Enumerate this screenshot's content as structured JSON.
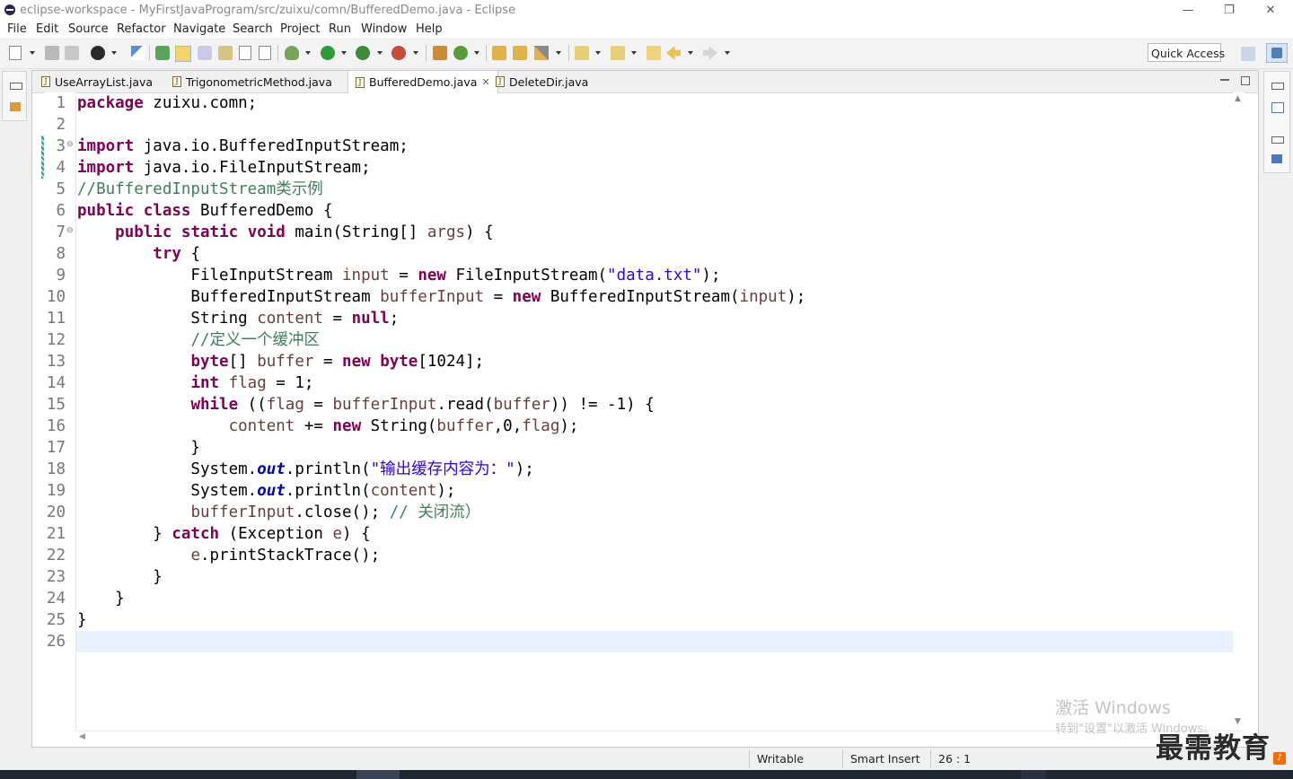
{
  "window": {
    "title": "eclipse-workspace - MyFirstJavaProgram/src/zuixu/comn/BufferedDemo.java - Eclipse",
    "minimize": "—",
    "restore": "❐",
    "close": "✕"
  },
  "menu": [
    "File",
    "Edit",
    "Source",
    "Refactor",
    "Navigate",
    "Search",
    "Project",
    "Run",
    "Window",
    "Help"
  ],
  "quick_access": "Quick Access",
  "tabs": [
    {
      "label": "UseArrayList.java"
    },
    {
      "label": "TrigonometricMethod.java"
    },
    {
      "label": "BufferedDemo.java",
      "active": true,
      "close": "✕"
    },
    {
      "label": "DeleteDir.java"
    }
  ],
  "code": {
    "line_numbers": [
      "1",
      "2",
      "3",
      "4",
      "5",
      "6",
      "7",
      "8",
      "9",
      "10",
      "11",
      "12",
      "13",
      "14",
      "15",
      "16",
      "17",
      "18",
      "19",
      "20",
      "21",
      "22",
      "23",
      "24",
      "25",
      "26"
    ],
    "fold_markers": {
      "3": "⊖",
      "7": "⊖"
    },
    "lines": [
      [
        {
          "t": "package",
          "c": "k"
        },
        {
          "t": " zuixu.comn;"
        }
      ],
      [],
      [
        {
          "t": "import",
          "c": "k"
        },
        {
          "t": " java.io.BufferedInputStream;"
        }
      ],
      [
        {
          "t": "import",
          "c": "k"
        },
        {
          "t": " java.io.FileInputStream;"
        }
      ],
      [
        {
          "t": "//BufferedInputStream类示例",
          "c": "c"
        }
      ],
      [
        {
          "t": "public",
          "c": "k"
        },
        {
          "t": " "
        },
        {
          "t": "class",
          "c": "k"
        },
        {
          "t": " BufferedDemo {"
        }
      ],
      [
        {
          "t": "    "
        },
        {
          "t": "public",
          "c": "k"
        },
        {
          "t": " "
        },
        {
          "t": "static",
          "c": "k"
        },
        {
          "t": " "
        },
        {
          "t": "void",
          "c": "k"
        },
        {
          "t": " main(String[] "
        },
        {
          "t": "args",
          "c": "v"
        },
        {
          "t": ") {"
        }
      ],
      [
        {
          "t": "        "
        },
        {
          "t": "try",
          "c": "k"
        },
        {
          "t": " {"
        }
      ],
      [
        {
          "t": "            FileInputStream "
        },
        {
          "t": "input",
          "c": "v"
        },
        {
          "t": " = "
        },
        {
          "t": "new",
          "c": "k"
        },
        {
          "t": " FileInputStream("
        },
        {
          "t": "\"data.txt\"",
          "c": "s"
        },
        {
          "t": ");"
        }
      ],
      [
        {
          "t": "            BufferedInputStream "
        },
        {
          "t": "bufferInput",
          "c": "v"
        },
        {
          "t": " = "
        },
        {
          "t": "new",
          "c": "k"
        },
        {
          "t": " BufferedInputStream("
        },
        {
          "t": "input",
          "c": "v"
        },
        {
          "t": ");"
        }
      ],
      [
        {
          "t": "            String "
        },
        {
          "t": "content",
          "c": "v"
        },
        {
          "t": " = "
        },
        {
          "t": "null",
          "c": "k"
        },
        {
          "t": ";"
        }
      ],
      [
        {
          "t": "            "
        },
        {
          "t": "//定义一个缓冲区",
          "c": "c"
        }
      ],
      [
        {
          "t": "            "
        },
        {
          "t": "byte",
          "c": "k"
        },
        {
          "t": "[] "
        },
        {
          "t": "buffer",
          "c": "v"
        },
        {
          "t": " = "
        },
        {
          "t": "new",
          "c": "k"
        },
        {
          "t": " "
        },
        {
          "t": "byte",
          "c": "k"
        },
        {
          "t": "[1024];"
        }
      ],
      [
        {
          "t": "            "
        },
        {
          "t": "int",
          "c": "k"
        },
        {
          "t": " "
        },
        {
          "t": "flag",
          "c": "v"
        },
        {
          "t": " = 1;"
        }
      ],
      [
        {
          "t": "            "
        },
        {
          "t": "while",
          "c": "k"
        },
        {
          "t": " (("
        },
        {
          "t": "flag",
          "c": "v"
        },
        {
          "t": " = "
        },
        {
          "t": "bufferInput",
          "c": "v"
        },
        {
          "t": ".read("
        },
        {
          "t": "buffer",
          "c": "v"
        },
        {
          "t": ")) != -1) {"
        }
      ],
      [
        {
          "t": "                "
        },
        {
          "t": "content",
          "c": "v"
        },
        {
          "t": " += "
        },
        {
          "t": "new",
          "c": "k"
        },
        {
          "t": " String("
        },
        {
          "t": "buffer",
          "c": "v"
        },
        {
          "t": ",0,"
        },
        {
          "t": "flag",
          "c": "v"
        },
        {
          "t": ");"
        }
      ],
      [
        {
          "t": "            }"
        }
      ],
      [
        {
          "t": "            System."
        },
        {
          "t": "out",
          "c": "f"
        },
        {
          "t": ".println("
        },
        {
          "t": "\"输出缓存内容为：\"",
          "c": "s"
        },
        {
          "t": ");"
        }
      ],
      [
        {
          "t": "            System."
        },
        {
          "t": "out",
          "c": "f"
        },
        {
          "t": ".println("
        },
        {
          "t": "content",
          "c": "v"
        },
        {
          "t": ");"
        }
      ],
      [
        {
          "t": "            "
        },
        {
          "t": "bufferInput",
          "c": "v"
        },
        {
          "t": ".close(); "
        },
        {
          "t": "// 关闭流）",
          "c": "c"
        }
      ],
      [
        {
          "t": "        } "
        },
        {
          "t": "catch",
          "c": "k"
        },
        {
          "t": " (Exception "
        },
        {
          "t": "e",
          "c": "v"
        },
        {
          "t": ") {"
        }
      ],
      [
        {
          "t": "            "
        },
        {
          "t": "e",
          "c": "v"
        },
        {
          "t": ".printStackTrace();"
        }
      ],
      [
        {
          "t": "        }"
        }
      ],
      [
        {
          "t": "    }"
        }
      ],
      [
        {
          "t": "}"
        }
      ],
      []
    ]
  },
  "status": {
    "writable": "Writable",
    "insert_mode": "Smart Insert",
    "position": "26 : 1"
  },
  "watermark": {
    "line1": "激活 Windows",
    "line2": "转到\"设置\"以激活 Windows。"
  },
  "brand": "最需教育",
  "colors": {
    "keyword": "#7f0055",
    "string": "#2a00ff",
    "comment": "#3f7f5f",
    "variable": "#6a3e3e",
    "field": "#0000c0",
    "current_line": "#e8f2fe",
    "change_marker": "#3e8f8a"
  }
}
